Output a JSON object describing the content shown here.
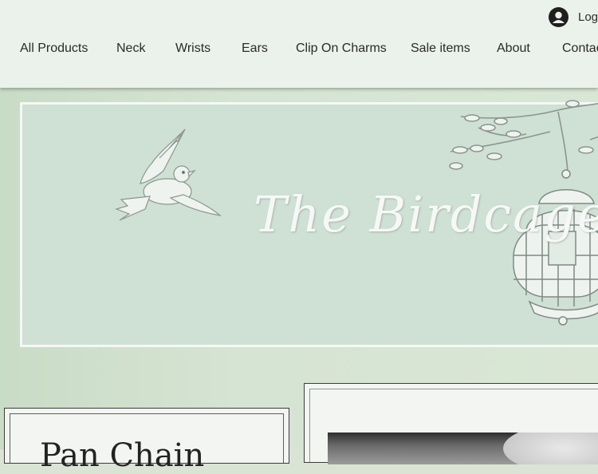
{
  "header": {
    "login_label": "Log",
    "nav": [
      {
        "label": "All Products"
      },
      {
        "label": "Neck"
      },
      {
        "label": "Wrists"
      },
      {
        "label": "Ears"
      },
      {
        "label": "Clip On Charms"
      },
      {
        "label": "Sale items"
      },
      {
        "label": "About"
      },
      {
        "label": "Contac"
      }
    ]
  },
  "banner": {
    "title": "The Birdcage",
    "icons": [
      "bird-icon",
      "branch-icon",
      "birdcage-icon"
    ]
  },
  "cards": {
    "left_heading": "Pan Chain",
    "right_image": "product-photo"
  },
  "colors": {
    "header_bg": "#ebf2eb",
    "banner_bg": "#cfe0d5",
    "page_bg": "#d9e4d4",
    "text": "#2a2a2a"
  }
}
